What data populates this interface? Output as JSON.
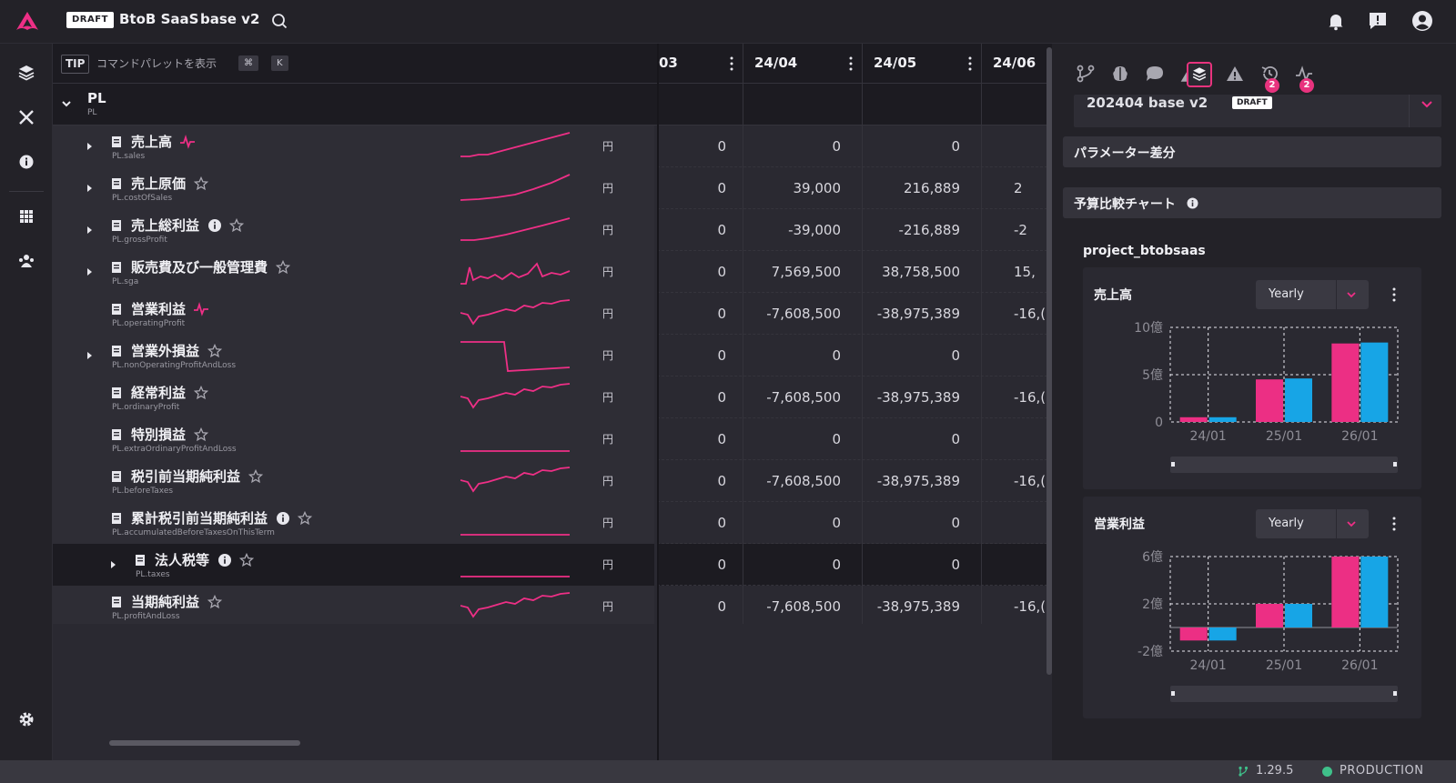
{
  "header": {
    "draft_badge": "DRAFT",
    "project": "BtoB SaaS",
    "scenario": "base v2"
  },
  "tip": {
    "badge": "TIP",
    "text": "コマンドパレットを表示",
    "key1": "⌘",
    "key2": "K"
  },
  "columns": [
    "03",
    "24/04",
    "24/05",
    "24/06"
  ],
  "group": {
    "label": "PL",
    "key": "PL"
  },
  "rows": [
    {
      "label": "売上高",
      "key": "PL.sales",
      "unit": "円",
      "values": [
        "0",
        "0",
        "0",
        ""
      ]
    },
    {
      "label": "売上原価",
      "key": "PL.costOfSales",
      "unit": "円",
      "values": [
        "0",
        "39,000",
        "216,889",
        "2"
      ]
    },
    {
      "label": "売上総利益",
      "key": "PL.grossProfit",
      "unit": "円",
      "values": [
        "0",
        "-39,000",
        "-216,889",
        "-2"
      ]
    },
    {
      "label": "販売費及び一般管理費",
      "key": "PL.sga",
      "unit": "円",
      "values": [
        "0",
        "7,569,500",
        "38,758,500",
        "15,"
      ]
    },
    {
      "label": "営業利益",
      "key": "PL.operatingProfit",
      "unit": "円",
      "values": [
        "0",
        "-7,608,500",
        "-38,975,389",
        "-16,("
      ]
    },
    {
      "label": "営業外損益",
      "key": "PL.nonOperatingProfitAndLoss",
      "unit": "円",
      "values": [
        "0",
        "0",
        "0",
        ""
      ]
    },
    {
      "label": "経常利益",
      "key": "PL.ordinaryProfit",
      "unit": "円",
      "values": [
        "0",
        "-7,608,500",
        "-38,975,389",
        "-16,("
      ]
    },
    {
      "label": "特別損益",
      "key": "PL.extraOrdinaryProfitAndLoss",
      "unit": "円",
      "values": [
        "0",
        "0",
        "0",
        ""
      ]
    },
    {
      "label": "税引前当期純利益",
      "key": "PL.beforeTaxes",
      "unit": "円",
      "values": [
        "0",
        "-7,608,500",
        "-38,975,389",
        "-16,("
      ]
    },
    {
      "label": "累計税引前当期純利益",
      "key": "PL.accumulatedBeforeTaxesOnThisTerm",
      "unit": "円",
      "values": [
        "0",
        "0",
        "0",
        ""
      ]
    },
    {
      "label": "法人税等",
      "key": "PL.taxes",
      "unit": "円",
      "values": [
        "0",
        "0",
        "0",
        ""
      ]
    },
    {
      "label": "当期純利益",
      "key": "PL.profitAndLoss",
      "unit": "円",
      "values": [
        "0",
        "-7,608,500",
        "-38,975,389",
        "-16,("
      ]
    }
  ],
  "panel": {
    "version_name": "202404 base v2",
    "version_badge": "DRAFT",
    "tab_badge_history": "2",
    "tab_badge_activity": "2",
    "param_diff_title": "パラメーター差分",
    "budget_chart_title": "予算比較チャート",
    "project_name": "project_btobsaas"
  },
  "chart_data": [
    {
      "type": "bar",
      "title": "売上高",
      "period": "Yearly",
      "categories": [
        "24/01",
        "25/01",
        "26/01"
      ],
      "y_ticks": [
        "0",
        "5億",
        "10億"
      ],
      "ylim": [
        0,
        10
      ],
      "series": [
        {
          "values": [
            0.5,
            4.5,
            8.3
          ],
          "color": "#ec2f84"
        },
        {
          "values": [
            0.5,
            4.6,
            8.4
          ],
          "color": "#17a5e6"
        }
      ]
    },
    {
      "type": "bar",
      "title": "営業利益",
      "period": "Yearly",
      "categories": [
        "24/01",
        "25/01",
        "26/01"
      ],
      "y_ticks": [
        "-2億",
        "2億",
        "6億"
      ],
      "ylim": [
        -2,
        6
      ],
      "series": [
        {
          "values": [
            -1.1,
            2.0,
            6.5
          ],
          "color": "#ec2f84"
        },
        {
          "values": [
            -1.1,
            2.0,
            6.5
          ],
          "color": "#17a5e6"
        }
      ]
    }
  ],
  "status": {
    "version": "1.29.5",
    "environment": "PRODUCTION"
  },
  "colors": {
    "accent": "#e8337e",
    "spark": "#ee2f86",
    "blue": "#17a5e6",
    "ok": "#3fc08a"
  }
}
